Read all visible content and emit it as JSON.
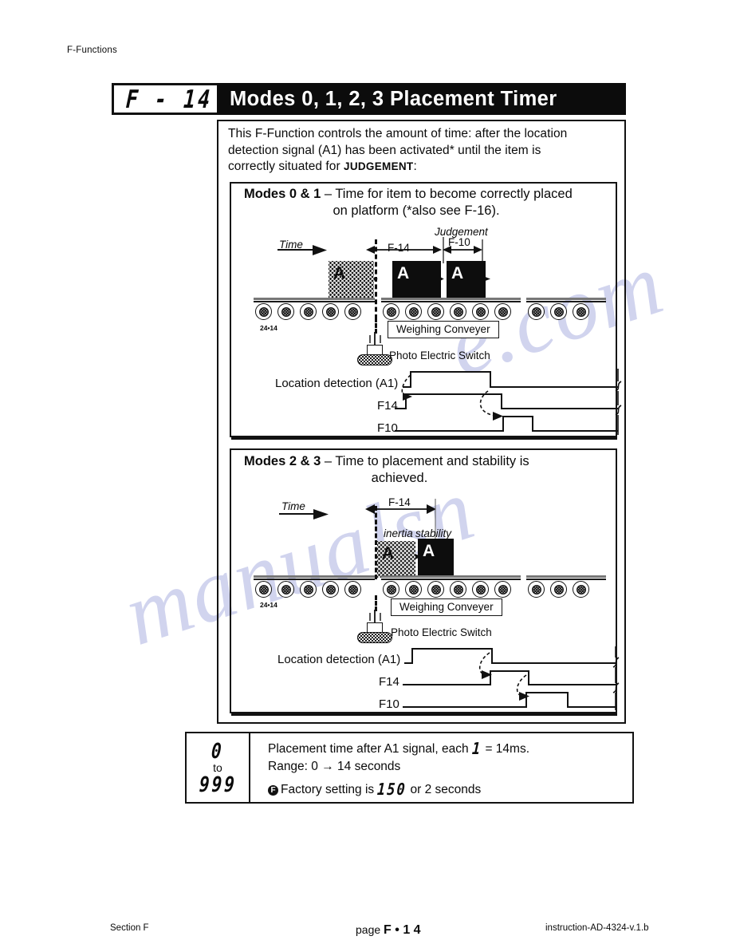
{
  "page": {
    "running_head": "F-Functions",
    "f_number": "F - 14",
    "title": "Modes 0, 1, 2, 3 Placement Timer",
    "intro_line1": "This F-Function controls the amount of time: after the location",
    "intro_line2": "detection signal (A1) has been activated* until the item is",
    "intro_line3_pre": "correctly situated for ",
    "intro_line3_sc": "JUDGEMENT",
    "intro_line3_post": ":"
  },
  "panel1": {
    "heading_bold": "Modes 0 & 1",
    "heading_dash": " – ",
    "heading_rest": "Time for item to become correctly placed",
    "heading_line2": "on platform (*also see F-16).",
    "time_label": "Time",
    "judgement_label": "Judgement",
    "dim_f14": "F-14",
    "dim_f10": "F-10",
    "block_letter": "A",
    "conveyor_code": "24•14",
    "weighing_conveyer": "Weighing Conveyer",
    "photo_switch": "Photo Electric Switch",
    "signal_a1": "Location detection (A1)",
    "signal_f14": "F14",
    "signal_f10": "F10"
  },
  "panel2": {
    "heading_bold": "Modes 2 & 3",
    "heading_dash": " – ",
    "heading_rest": "Time to placement and stability is",
    "heading_line2": "achieved.",
    "time_label": "Time",
    "dim_f14": "F-14",
    "inertia_label": "inertia",
    "stability_label": "stability",
    "block_letter": "A",
    "conveyor_code": "24•14",
    "weighing_conveyer": "Weighing Conveyer",
    "photo_switch": "Photo Electric Switch",
    "signal_a1": "Location detection (A1)",
    "signal_f14": "F14",
    "signal_f10": "F10"
  },
  "range": {
    "min": "0",
    "to": "to",
    "max": "999",
    "line1_pre": "Placement time after A1 signal, each ",
    "line1_seg": "1",
    "line1_post": " = 14ms.",
    "line2": "Range: 0 → 14 seconds",
    "line3_pre": "Factory setting is ",
    "line3_seg": "150",
    "line3_post": " or 2 seconds",
    "fmark": "F"
  },
  "footer": {
    "section": "Section F",
    "page_pre": "page ",
    "page_num": "F • 1 4",
    "instruction": "instruction-AD-4324-v.1.b"
  },
  "watermark": {
    "text1": "manualsn",
    "text2": "e.com"
  },
  "colors": {
    "ink": "#0c0c0c",
    "paper": "#ffffff",
    "watermark": "#c9cdec"
  }
}
